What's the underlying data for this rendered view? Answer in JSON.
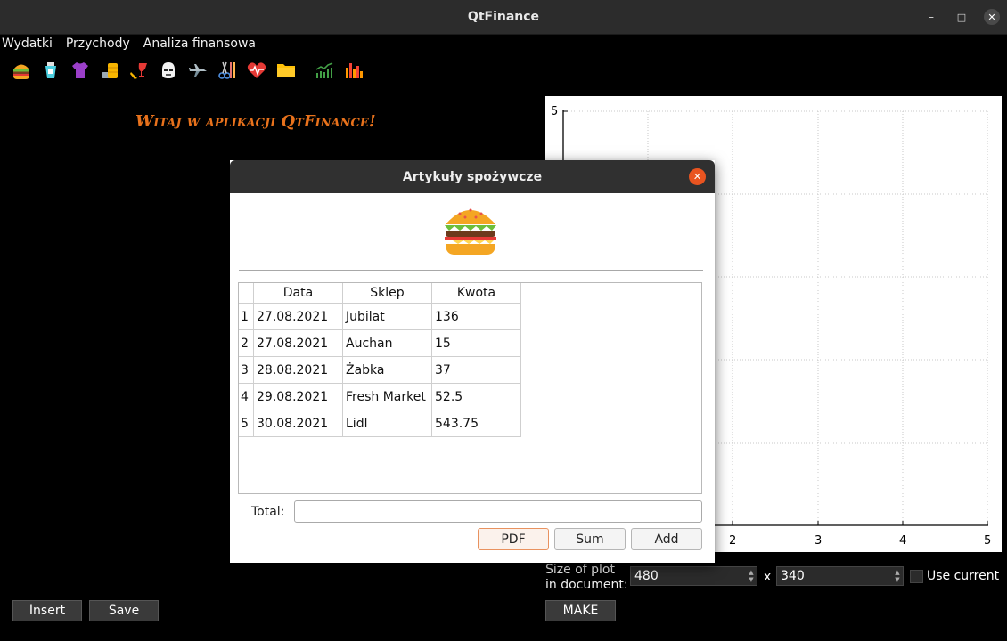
{
  "window": {
    "title": "QtFinance",
    "controls": {
      "minimize": "–",
      "maximize": "□",
      "close": "✕"
    }
  },
  "menubar": [
    "Wydatki",
    "Przychody",
    "Analiza finansowa"
  ],
  "toolbar": {
    "icons": [
      "burger-icon",
      "toothpaste-icon",
      "tshirt-icon",
      "coins-icon",
      "wine-icon",
      "stormtrooper-icon",
      "airplane-icon",
      "scissors-icon",
      "heart-icon",
      "folder-icon",
      "line-chart-icon",
      "bar-chart-icon"
    ]
  },
  "main": {
    "welcome": "Witaj w aplikacji QtFinance!",
    "plot": {
      "y_max_tick": "5",
      "x_ticks": [
        "2",
        "3",
        "4",
        "5"
      ],
      "grid": true
    },
    "size_label_line1": "Size of plot",
    "size_label_line2": "in document:",
    "width_value": "480",
    "times": "x",
    "height_value": "340",
    "use_current_label": "Use current",
    "make_label": "MAKE",
    "insert_label": "Insert",
    "save_label": "Save"
  },
  "dialog": {
    "title": "Artykuły spożywcze",
    "columns": [
      "Data",
      "Sklep",
      "Kwota"
    ],
    "rows": [
      {
        "num": "1",
        "date": "27.08.2021",
        "shop": "Jubilat",
        "amount": "136"
      },
      {
        "num": "2",
        "date": "27.08.2021",
        "shop": "Auchan",
        "amount": "15"
      },
      {
        "num": "3",
        "date": "28.08.2021",
        "shop": "Żabka",
        "amount": "37"
      },
      {
        "num": "4",
        "date": "29.08.2021",
        "shop": "Fresh Market",
        "amount": "52.5"
      },
      {
        "num": "5",
        "date": "30.08.2021",
        "shop": "Lidl",
        "amount": "543.75"
      }
    ],
    "total_label": "Total:",
    "total_value": "",
    "pdf_label": "PDF",
    "sum_label": "Sum",
    "add_label": "Add"
  },
  "colors": {
    "accent": "#e95420",
    "welcome": "#e8721c",
    "background": "#000000"
  }
}
